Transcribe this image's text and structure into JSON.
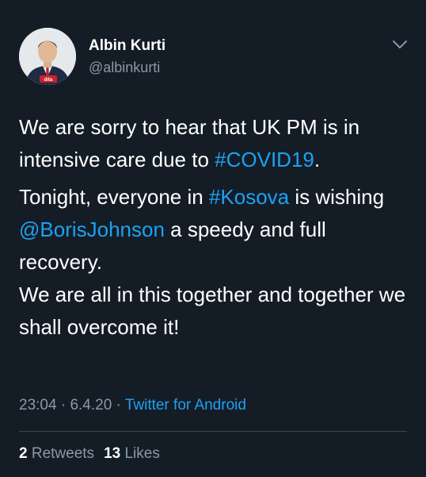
{
  "user": {
    "name": "Albin Kurti",
    "handle": "@albinkurti",
    "avatar_badge": "dita"
  },
  "tweet": {
    "p1_a": "We are sorry to hear that UK PM is in intensive care due to ",
    "p1_hashtag": "#COVID19",
    "p1_b": ".",
    "p2_a": "Tonight, everyone in ",
    "p2_hashtag": "#Kosova",
    "p2_b": " is wishing ",
    "p2_mention": "@BorisJohnson",
    "p2_c": " a speedy and full recovery.",
    "p3": "We are all in this together and together we shall overcome it!"
  },
  "meta": {
    "time": "23:04",
    "sep1": " · ",
    "date": "6.4.20",
    "sep2": " · ",
    "source": "Twitter for Android"
  },
  "stats": {
    "retweets_count": "2",
    "retweets_label": "Retweets",
    "likes_count": "13",
    "likes_label": "Likes"
  },
  "colors": {
    "background": "#141d26",
    "link": "#1da1f2",
    "secondary": "#8899a6",
    "text": "#ffffff"
  },
  "icons": {
    "menu": "chevron-down-icon"
  }
}
